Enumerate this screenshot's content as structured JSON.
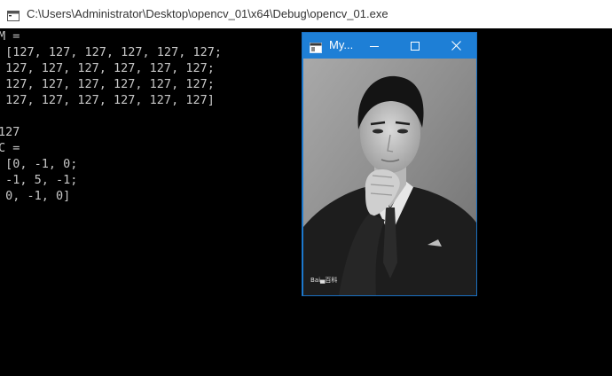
{
  "window": {
    "title": "C:\\Users\\Administrator\\Desktop\\opencv_01\\x64\\Debug\\opencv_01.exe"
  },
  "console": {
    "lines": [
      "M =",
      " [127, 127, 127, 127, 127, 127;",
      " 127, 127, 127, 127, 127, 127;",
      " 127, 127, 127, 127, 127, 127;",
      " 127, 127, 127, 127, 127, 127]",
      "",
      "127",
      "C =",
      " [0, -1, 0;",
      " -1, 5, -1;",
      " 0, -1, 0]"
    ]
  },
  "image_window": {
    "title": "My...",
    "watermark": "Bai▄百科"
  },
  "colors": {
    "titlebar_bg": "#ffffff",
    "console_bg": "#000000",
    "console_text": "#c8c8c8",
    "accent": "#1e7fd6"
  },
  "icons": {
    "app": "console-app-icon",
    "minimize": "minimize-icon",
    "maximize": "maximize-icon",
    "close": "close-icon"
  }
}
